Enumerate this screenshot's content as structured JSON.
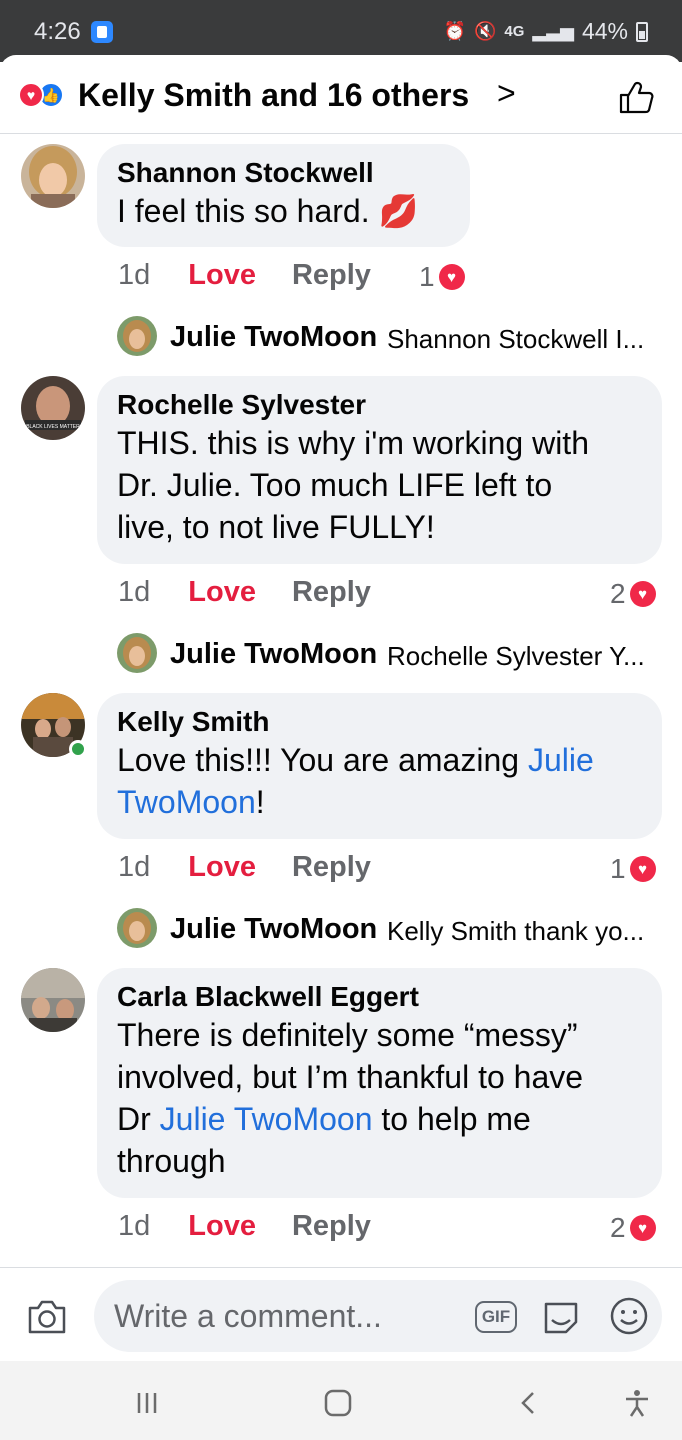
{
  "status_bar": {
    "time": "4:26",
    "network": "4G",
    "battery": "44%"
  },
  "header": {
    "title": "Kelly Smith and 16 others",
    "chevron": ">"
  },
  "comments": [
    {
      "author": "Shannon Stockwell",
      "text": "I feel this so hard. 💋",
      "time": "1d",
      "love": "Love",
      "reply": "Reply",
      "reactions": "1",
      "reply_author": "Julie TwoMoon",
      "reply_preview": "Shannon Stockwell I..."
    },
    {
      "author": "Rochelle Sylvester",
      "text_lines": [
        "THIS. this is why i'm working with",
        "Dr. Julie. Too much LIFE left to",
        "live, to not live FULLY!"
      ],
      "time": "1d",
      "love": "Love",
      "reply": "Reply",
      "reactions": "2",
      "reply_author": "Julie TwoMoon",
      "reply_preview": "Rochelle Sylvester Y..."
    },
    {
      "author": "Kelly Smith",
      "text_pre": "Love this!!! You are amazing ",
      "tag_line1": "Julie",
      "tag_line2": "TwoMoon",
      "text_post": "!",
      "time": "1d",
      "love": "Love",
      "reply": "Reply",
      "reactions": "1",
      "reply_author": "Julie TwoMoon",
      "reply_preview": "Kelly Smith thank yo..."
    },
    {
      "author": "Carla Blackwell Eggert",
      "line1": "There is definitely some “messy”",
      "line2": "involved, but I’m thankful to have",
      "line3_pre": "Dr ",
      "line3_tag": "Julie TwoMoon",
      "line3_post": " to help me",
      "line4": "through",
      "time": "1d",
      "love": "Love",
      "reply": "Reply",
      "reactions": "2"
    }
  ],
  "composer": {
    "placeholder": "Write a comment...",
    "gif_label": "GIF"
  },
  "colors": {
    "love": "#e41e3f",
    "tag": "#216fdb",
    "bubble": "#f0f2f5",
    "online": "#31a24c"
  }
}
